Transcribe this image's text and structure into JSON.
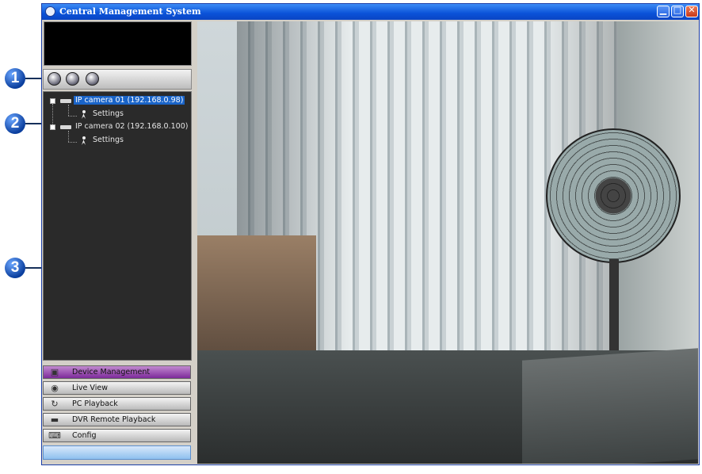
{
  "window": {
    "title": "Central Management System",
    "controls": [
      "minimize",
      "restore",
      "close"
    ]
  },
  "toolbar": {
    "buttons": [
      {
        "icon": "camera-search-icon"
      },
      {
        "icon": "help-icon"
      },
      {
        "icon": "tools-icon"
      }
    ]
  },
  "tree": {
    "cameras": [
      {
        "label": "IP camera 01 (192.168.0.98)",
        "selected": true,
        "child": "Settings"
      },
      {
        "label": "IP camera 02 (192.168.0.100)",
        "selected": false,
        "child": "Settings"
      }
    ]
  },
  "menu": {
    "items": [
      {
        "label": "Device Management",
        "icon": "device-management-icon",
        "active": true
      },
      {
        "label": "Live View",
        "icon": "live-view-icon",
        "active": false
      },
      {
        "label": "PC Playback",
        "icon": "pc-playback-icon",
        "active": false
      },
      {
        "label": "DVR Remote Playback",
        "icon": "dvr-remote-playback-icon",
        "active": false
      },
      {
        "label": "Config",
        "icon": "config-icon",
        "active": false
      }
    ]
  },
  "callouts": [
    "1",
    "2",
    "3"
  ],
  "colors": {
    "titlebar": "#0a52d8",
    "selection": "#1a64c8",
    "active_menu": "#7d2a9a",
    "callout": "#0b3f9e"
  }
}
